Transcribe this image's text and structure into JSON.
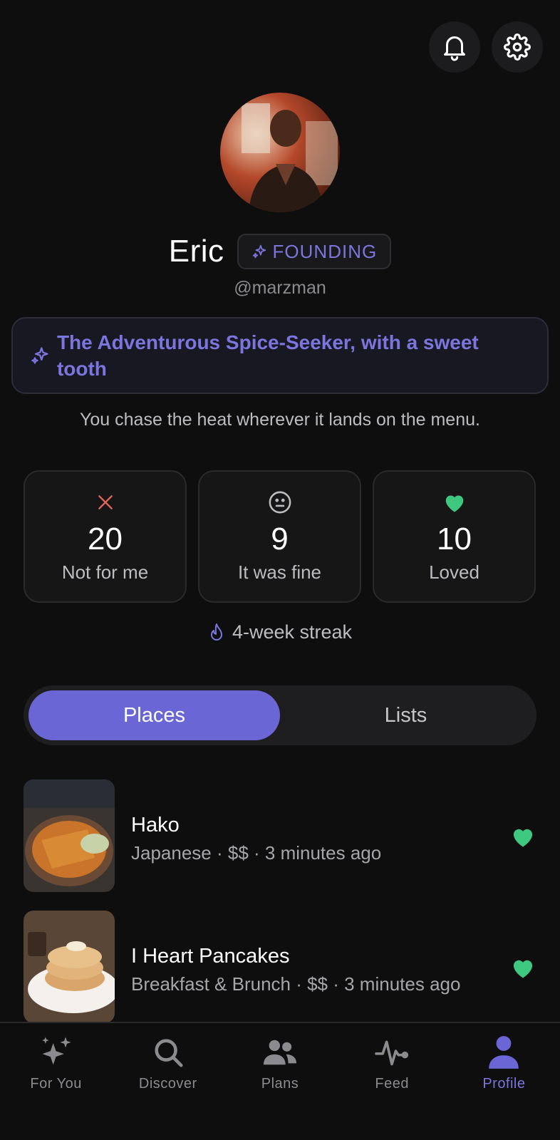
{
  "header": {
    "notifications_icon": "bell-icon",
    "settings_icon": "gear-icon"
  },
  "profile": {
    "name": "Eric",
    "badge": "FOUNDING",
    "handle": "@marzman",
    "persona_title": "The Adventurous Spice-Seeker, with a sweet tooth",
    "persona_description": "You chase the heat wherever it lands on the menu."
  },
  "stats": [
    {
      "value": "20",
      "label": "Not for me",
      "icon": "x-icon",
      "color": "#e0655e"
    },
    {
      "value": "9",
      "label": "It was fine",
      "icon": "neutral-face-icon",
      "color": "#bdbdc1"
    },
    {
      "value": "10",
      "label": "Loved",
      "icon": "heart-icon",
      "color": "#3ec77f"
    }
  ],
  "streak": "4-week streak",
  "tabs": [
    {
      "label": "Places",
      "active": true
    },
    {
      "label": "Lists",
      "active": false
    }
  ],
  "places": [
    {
      "name": "Hako",
      "meta": "Japanese · $$ · 3 minutes ago",
      "reaction": "heart-icon"
    },
    {
      "name": "I Heart Pancakes",
      "meta": "Breakfast & Brunch · $$ · 3 minutes ago",
      "reaction": "heart-icon"
    }
  ],
  "nav": [
    {
      "label": "For You",
      "icon": "sparkles-icon",
      "active": false
    },
    {
      "label": "Discover",
      "icon": "search-icon",
      "active": false
    },
    {
      "label": "Plans",
      "icon": "people-icon",
      "active": false
    },
    {
      "label": "Feed",
      "icon": "pulse-icon",
      "active": false
    },
    {
      "label": "Profile",
      "icon": "person-icon",
      "active": true
    }
  ],
  "colors": {
    "accent": "#6b66d6",
    "accent_text": "#7b75de",
    "loved": "#3ec77f",
    "not_for_me": "#e0655e",
    "background": "#0e0e0f"
  }
}
